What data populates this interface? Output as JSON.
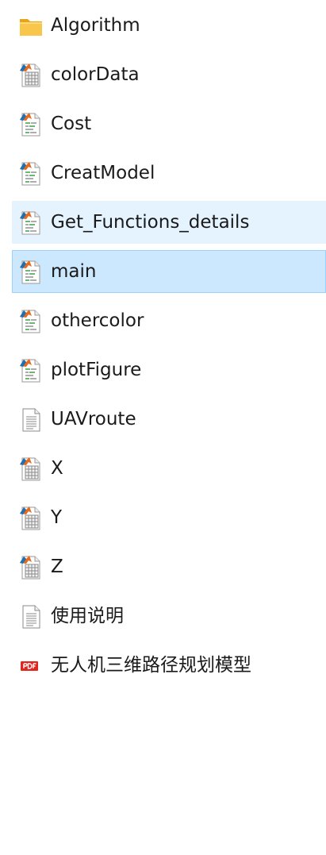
{
  "files": [
    {
      "name": "Algorithm",
      "icon": "folder-icon",
      "state": "normal"
    },
    {
      "name": "colorData",
      "icon": "matlab-data-icon",
      "state": "normal"
    },
    {
      "name": "Cost",
      "icon": "matlab-script-icon",
      "state": "normal"
    },
    {
      "name": "CreatModel",
      "icon": "matlab-script-icon",
      "state": "normal"
    },
    {
      "name": "Get_Functions_details",
      "icon": "matlab-script-icon",
      "state": "hover"
    },
    {
      "name": "main",
      "icon": "matlab-script-icon",
      "state": "selected"
    },
    {
      "name": "othercolor",
      "icon": "matlab-script-icon",
      "state": "normal"
    },
    {
      "name": "plotFigure",
      "icon": "matlab-script-icon",
      "state": "normal"
    },
    {
      "name": "UAVroute",
      "icon": "text-file-icon",
      "state": "normal"
    },
    {
      "name": "X",
      "icon": "matlab-data-icon",
      "state": "normal"
    },
    {
      "name": "Y",
      "icon": "matlab-data-icon",
      "state": "normal"
    },
    {
      "name": "Z",
      "icon": "matlab-data-icon",
      "state": "normal"
    },
    {
      "name": "使用说明",
      "icon": "text-file-icon",
      "state": "normal"
    },
    {
      "name": "无人机三维路径规划模型",
      "icon": "pdf-icon",
      "state": "normal"
    }
  ],
  "colors": {
    "hover_bg": "#e5f3ff",
    "selected_bg": "#cce8ff",
    "selected_border": "#99d1ff",
    "folder": "#f8c64b",
    "pdf_red": "#e0261f"
  }
}
